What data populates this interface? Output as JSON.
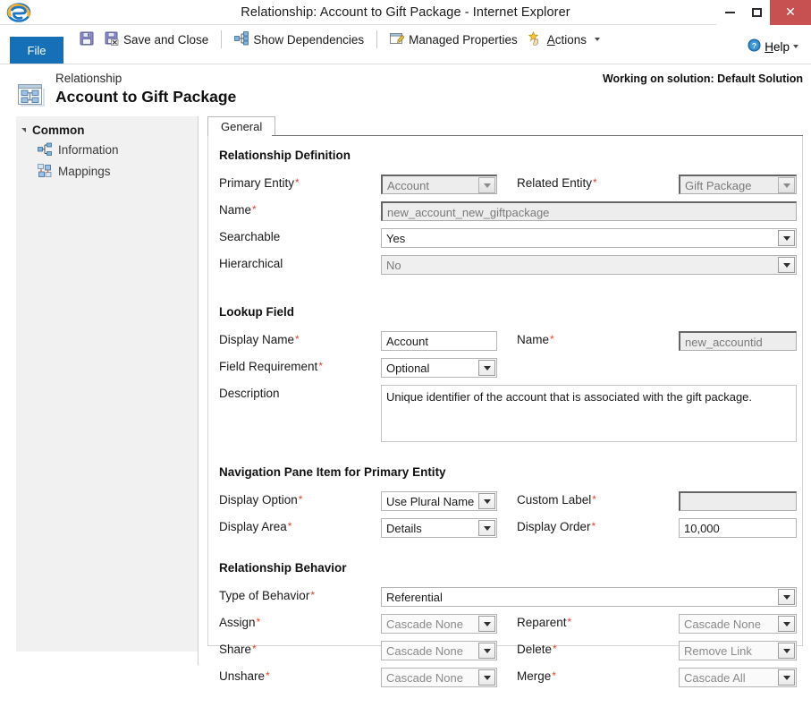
{
  "window": {
    "title": "Relationship: Account to Gift Package - Internet Explorer",
    "app_icon": "internet-explorer-icon",
    "minimize_label": "Minimize",
    "maximize_label": "Maximize",
    "close_label": "Close"
  },
  "ribbon": {
    "file_tab": "File",
    "save_icon": "save-icon",
    "save_and_close_icon": "save-and-close-icon",
    "save_and_close": "Save and Close",
    "show_dependencies_icon": "dependencies-icon",
    "show_dependencies": "Show Dependencies",
    "managed_properties_icon": "managed-properties-icon",
    "managed_properties": "Managed Properties",
    "actions_icon": "actions-icon",
    "actions": "Actions",
    "help_icon": "help-icon",
    "help": "Help"
  },
  "header": {
    "icon": "relationship-icon",
    "subtitle": "Relationship",
    "title": "Account to Gift Package",
    "solution_note": "Working on solution: Default Solution"
  },
  "sidebar": {
    "group_label": "Common",
    "items": [
      {
        "label": "Information",
        "icon": "information-icon"
      },
      {
        "label": "Mappings",
        "icon": "mappings-icon"
      }
    ]
  },
  "tabs": [
    {
      "label": "General",
      "active": true
    }
  ],
  "form": {
    "sections": [
      {
        "title": "Relationship Definition",
        "fields": {
          "primary_entity_label": "Primary Entity",
          "primary_entity_value": "Account",
          "related_entity_label": "Related Entity",
          "related_entity_value": "Gift Package",
          "name_label": "Name",
          "name_value": "new_account_new_giftpackage",
          "searchable_label": "Searchable",
          "searchable_value": "Yes",
          "hierarchical_label": "Hierarchical",
          "hierarchical_value": "No"
        }
      },
      {
        "title": "Lookup Field",
        "fields": {
          "display_name_label": "Display Name",
          "display_name_value": "Account",
          "name_label": "Name",
          "name_value": "new_accountid",
          "field_requirement_label": "Field Requirement",
          "field_requirement_value": "Optional",
          "description_label": "Description",
          "description_value": "Unique identifier of the account that is associated with the gift package."
        }
      },
      {
        "title": "Navigation Pane Item for Primary Entity",
        "fields": {
          "display_option_label": "Display Option",
          "display_option_value": "Use Plural Name",
          "custom_label_label": "Custom Label",
          "custom_label_value": "",
          "display_area_label": "Display Area",
          "display_area_value": "Details",
          "display_order_label": "Display Order",
          "display_order_value": "10,000"
        }
      },
      {
        "title": "Relationship Behavior",
        "fields": {
          "type_of_behavior_label": "Type of Behavior",
          "type_of_behavior_value": "Referential",
          "assign_label": "Assign",
          "assign_value": "Cascade None",
          "reparent_label": "Reparent",
          "reparent_value": "Cascade None",
          "share_label": "Share",
          "share_value": "Cascade None",
          "delete_label": "Delete",
          "delete_value": "Remove Link",
          "unshare_label": "Unshare",
          "unshare_value": "Cascade None",
          "merge_label": "Merge",
          "merge_value": "Cascade All"
        }
      }
    ]
  },
  "colors": {
    "file_tab_blue": "#1570b8",
    "close_red": "#c75050",
    "required_red": "#e0452b"
  }
}
